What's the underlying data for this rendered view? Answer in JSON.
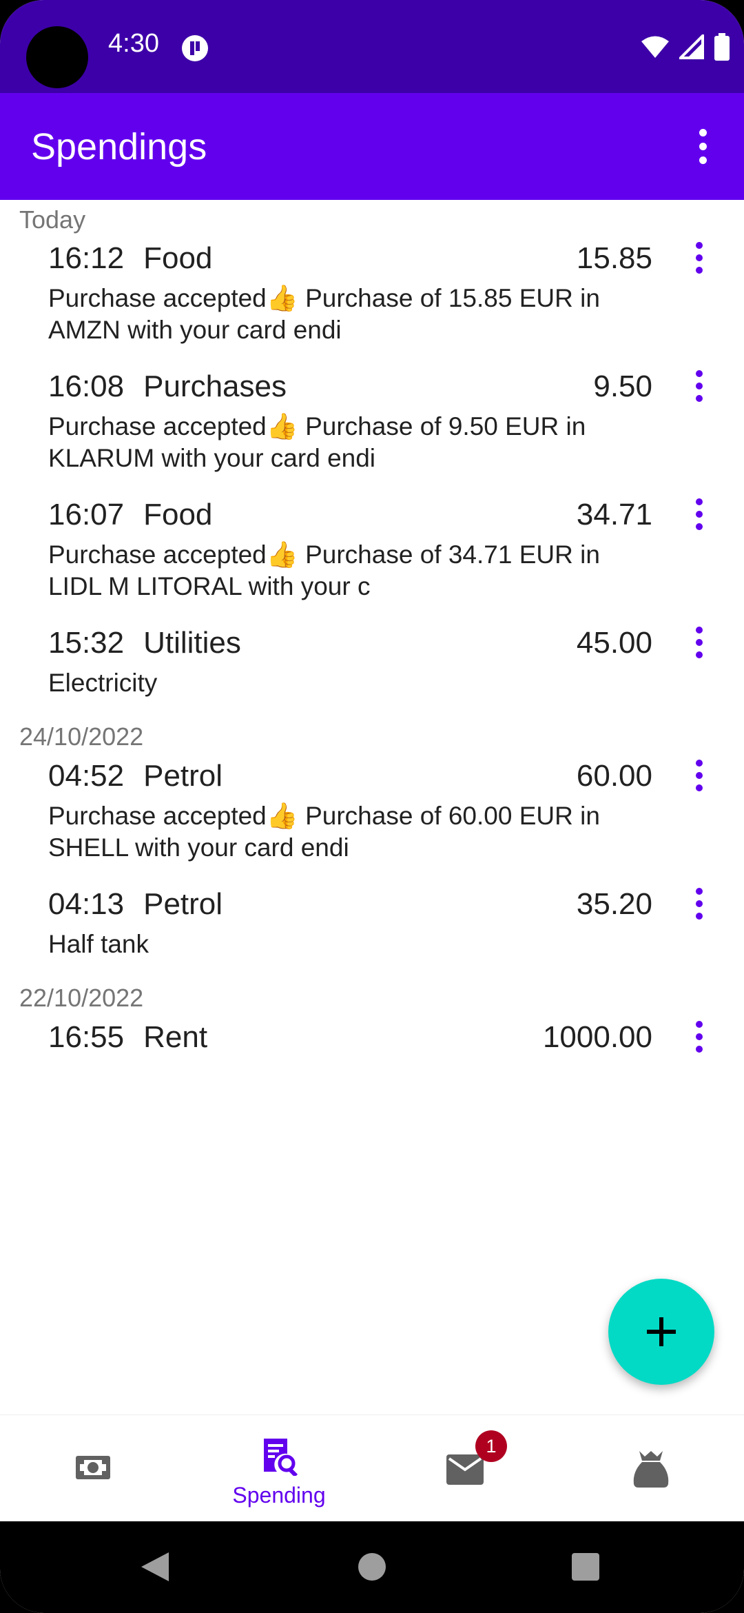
{
  "status_bar": {
    "time": "4:30"
  },
  "app_bar": {
    "title": "Spendings"
  },
  "groups": [
    {
      "date": "Today",
      "items": [
        {
          "time": "16:12",
          "category": "Food",
          "amount": "15.85",
          "desc_line1": "Purchase accepted👍 Purchase of 15.85 EUR in",
          "desc_line2": "AMZN  with your card endi"
        },
        {
          "time": "16:08",
          "category": "Purchases",
          "amount": "9.50",
          "desc_line1": "Purchase accepted👍 Purchase of 9.50 EUR in",
          "desc_line2": "KLARUM  with your card endi"
        },
        {
          "time": "16:07",
          "category": "Food",
          "amount": "34.71",
          "desc_line1": "Purchase accepted👍 Purchase of 34.71 EUR in",
          "desc_line2": "LIDL M LITORAL with your c"
        },
        {
          "time": "15:32",
          "category": "Utilities",
          "amount": "45.00",
          "desc_line1": "Electricity",
          "desc_line2": ""
        }
      ]
    },
    {
      "date": "24/10/2022",
      "items": [
        {
          "time": "04:52",
          "category": "Petrol",
          "amount": "60.00",
          "desc_line1": "Purchase accepted👍 Purchase of 60.00 EUR in",
          "desc_line2": "SHELL with your card endi"
        },
        {
          "time": "04:13",
          "category": "Petrol",
          "amount": "35.20",
          "desc_line1": "Half tank",
          "desc_line2": ""
        }
      ]
    },
    {
      "date": "22/10/2022",
      "items": [
        {
          "time": "16:55",
          "category": "Rent",
          "amount": "1000.00",
          "desc_line1": "",
          "desc_line2": ""
        }
      ]
    }
  ],
  "fab": {
    "icon": "plus-icon"
  },
  "bottom_nav": {
    "items": [
      {
        "icon": "money-icon",
        "label": ""
      },
      {
        "icon": "receipt-search-icon",
        "label": "Spending"
      },
      {
        "icon": "mail-icon",
        "label": "",
        "badge": "1"
      },
      {
        "icon": "money-bag-icon",
        "label": ""
      }
    ]
  },
  "colors": {
    "status_bar": "#3d00a8",
    "app_bar": "#6200ee",
    "accent": "#6200ee",
    "fab": "#03dac5",
    "badge": "#b00020"
  }
}
